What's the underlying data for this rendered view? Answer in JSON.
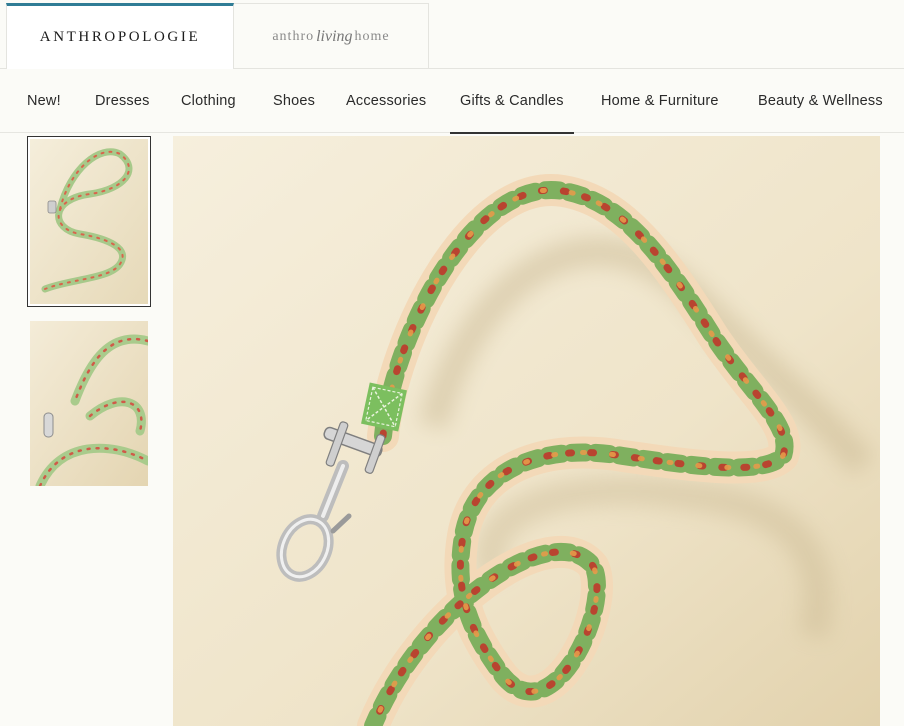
{
  "brands": {
    "anthropologie": "ANTHROPOLOGIE",
    "living_prefix": "anthro",
    "living_script": "living",
    "living_suffix": "home"
  },
  "nav": {
    "items": [
      {
        "label": "New!"
      },
      {
        "label": "Dresses"
      },
      {
        "label": "Clothing"
      },
      {
        "label": "Shoes"
      },
      {
        "label": "Accessories"
      },
      {
        "label": "Gifts & Candles",
        "active": true
      },
      {
        "label": "Home & Furniture"
      },
      {
        "label": "Beauty & Wellness"
      }
    ]
  },
  "product": {
    "thumbnails": [
      {
        "selected": true
      },
      {
        "selected": false
      }
    ]
  },
  "colors": {
    "accent": "#2f7c95",
    "background": "#fbfbf7",
    "photo_background": "#f1e8d3",
    "leash_base": "#f3d9b8",
    "leash_leaf": "#6aa84f",
    "leash_flower": "#c0392b",
    "metal": "#c9c9c9"
  }
}
